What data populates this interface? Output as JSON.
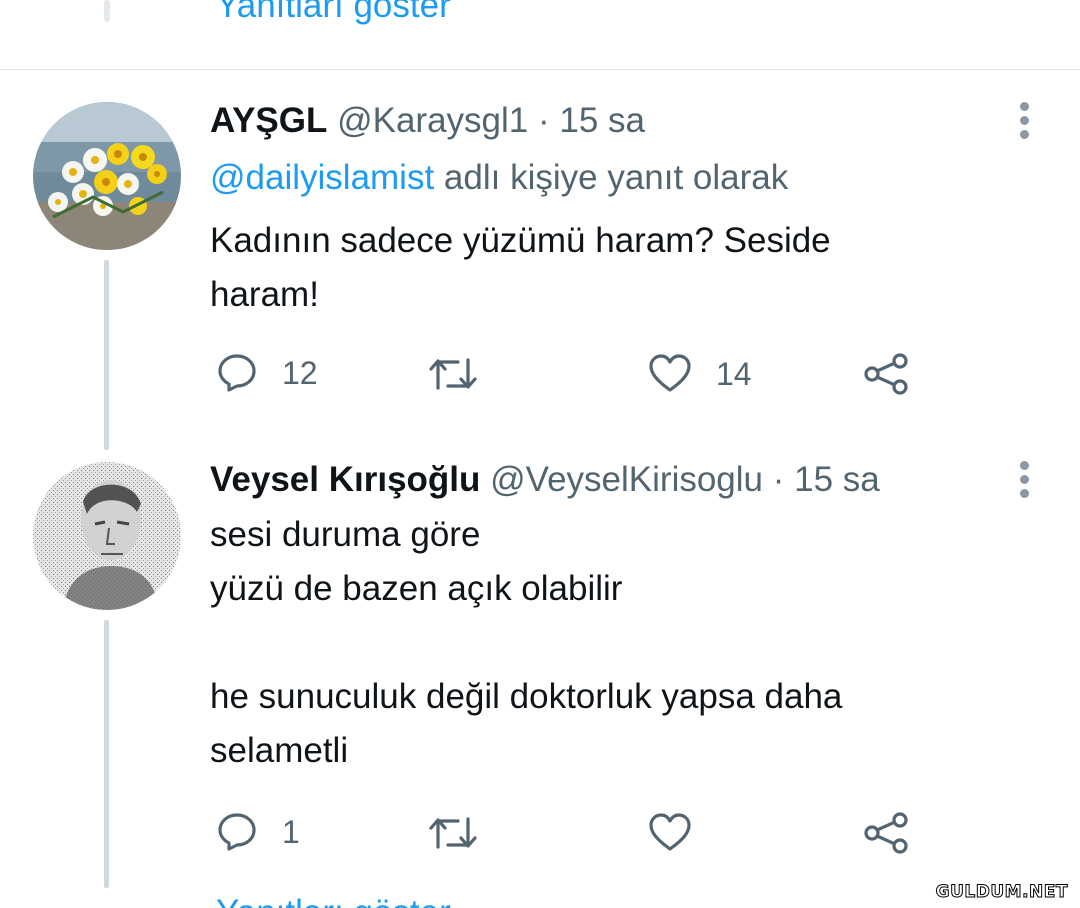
{
  "top": {
    "show_replies": "Yanıtları göster"
  },
  "tweets": [
    {
      "name": "AYŞGL",
      "handle": "@Karaysgl1",
      "time": "15 sa",
      "reply_to_handle": "@dailyislamist",
      "reply_to_suffix": "adlı kişiye yanıt olarak",
      "text": "Kadının sadece yüzümü haram? Seside\nharam!",
      "replies": "12",
      "retweets": "",
      "likes": "14",
      "avatar": "flowers-avatar"
    },
    {
      "name": "Veysel Kırışoğlu",
      "handle": "@VeyselKirisoglu",
      "time": "15 sa",
      "text": "sesi duruma göre\nyüzü de bazen açık olabilir\n\nhe sunuculuk değil doktorluk yapsa daha\nselametli",
      "replies": "1",
      "retweets": "",
      "likes": "",
      "avatar": "grayscale-portrait-avatar"
    }
  ],
  "bottom": {
    "show_replies_partial": "Yanıtları göster"
  },
  "watermark": "GULDUM.NET",
  "colors": {
    "link": "#1d9bf0",
    "muted": "#536471",
    "thread_line": "#cfd9de"
  }
}
